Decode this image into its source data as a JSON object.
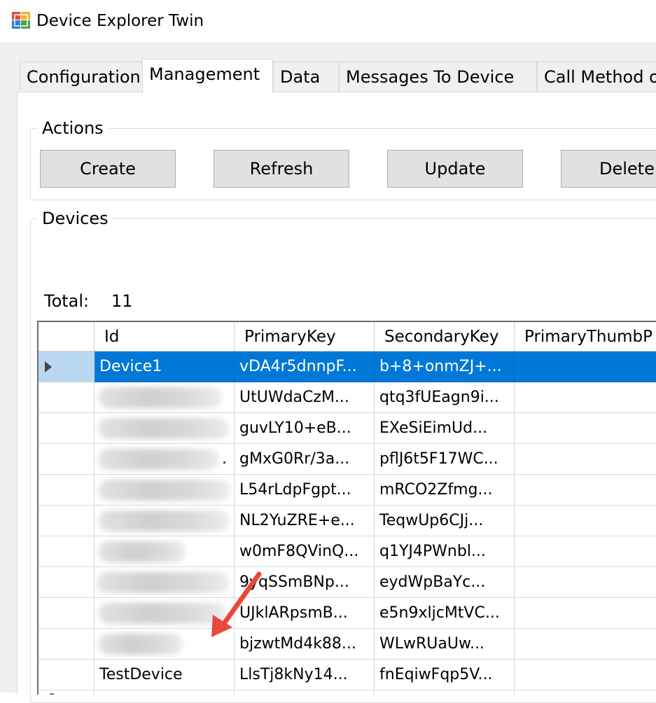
{
  "window": {
    "title": "Device Explorer Twin",
    "icon": "app-window-icon"
  },
  "tabs": [
    {
      "label": "Configuration",
      "active": false
    },
    {
      "label": "Management",
      "active": true
    },
    {
      "label": "Data",
      "active": false
    },
    {
      "label": "Messages To Device",
      "active": false
    },
    {
      "label": "Call Method o",
      "active": false
    }
  ],
  "actions": {
    "legend": "Actions",
    "create_label": "Create",
    "refresh_label": "Refresh",
    "update_label": "Update",
    "delete_label": "Delete"
  },
  "devices": {
    "legend": "Devices",
    "total_label": "Total:",
    "total_value": "11",
    "columns": [
      "Id",
      "PrimaryKey",
      "SecondaryKey",
      "PrimaryThumbP"
    ],
    "rows": [
      {
        "id": "Device1",
        "primary_key": "vDA4r5dnnpF...",
        "secondary_key": "b+8+onmZJ+...",
        "selected": true
      },
      {
        "id": "",
        "primary_key": "UtUWdaCzM...",
        "secondary_key": "qtq3fUEagn9i..."
      },
      {
        "id": "",
        "primary_key": "guvLY10+eB...",
        "secondary_key": "EXeSiEimUd..."
      },
      {
        "id": ".",
        "primary_key": "gMxG0Rr/3a...",
        "secondary_key": "pflJ6t5F17WC..."
      },
      {
        "id": "",
        "primary_key": "L54rLdpFgpt...",
        "secondary_key": "mRCO2Zfmg..."
      },
      {
        "id": "",
        "primary_key": "NL2YuZRE+e...",
        "secondary_key": "TeqwUp6CJj..."
      },
      {
        "id": "",
        "primary_key": "w0mF8QVinQ...",
        "secondary_key": "q1YJ4PWnbl..."
      },
      {
        "id": "",
        "primary_key": "9yqSSmBNp...",
        "secondary_key": "eydWpBaYc..."
      },
      {
        "id": "",
        "primary_key": "UJklARpsmB...",
        "secondary_key": "e5n9xljcMtVC..."
      },
      {
        "id": "",
        "primary_key": "bjzwtMd4k88...",
        "secondary_key": "WLwRUaUw..."
      },
      {
        "id": "TestDevice",
        "primary_key": "LlsTj8kNy14...",
        "secondary_key": "fnEqiwFqp5V..."
      }
    ],
    "current_row_marker": "current-row-arrow-icon",
    "new_row_marker": "new-row-asterisk-icon"
  },
  "colors": {
    "selection": "#0078d7",
    "annotation_arrow": "#e8493a"
  }
}
